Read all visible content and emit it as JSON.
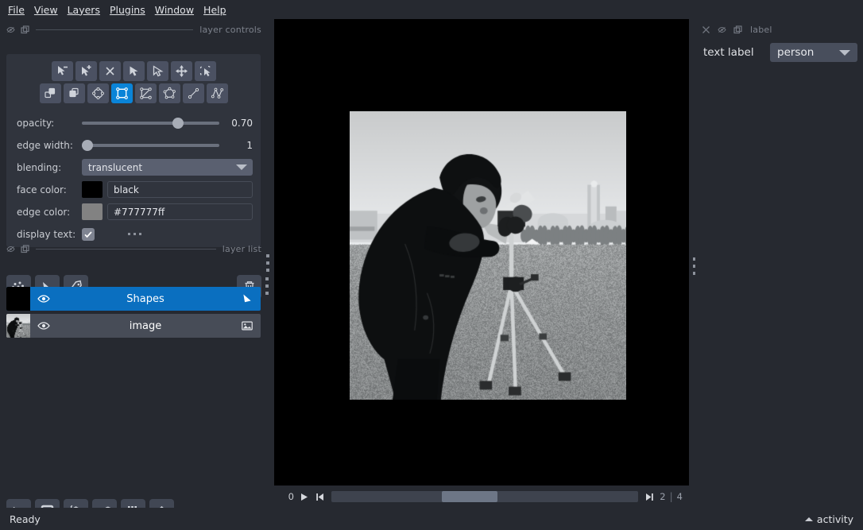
{
  "menubar": {
    "items": [
      {
        "label": "File",
        "mnemonic": "F"
      },
      {
        "label": "View",
        "mnemonic": "V"
      },
      {
        "label": "Layers",
        "mnemonic": "L"
      },
      {
        "label": "Plugins",
        "mnemonic": "P"
      },
      {
        "label": "Window",
        "mnemonic": "W"
      },
      {
        "label": "Help",
        "mnemonic": "H"
      }
    ]
  },
  "layer_controls": {
    "title": "layer controls",
    "tools_row1": [
      {
        "name": "select-subtract-tool",
        "icon": "arrow-minus-icon",
        "active": false
      },
      {
        "name": "select-add-tool",
        "icon": "arrow-plus-icon",
        "active": false
      },
      {
        "name": "delete-shape-tool",
        "icon": "close-icon",
        "active": false
      },
      {
        "name": "direct-select-tool",
        "icon": "pointer-filled-icon",
        "active": false
      },
      {
        "name": "select-tool",
        "icon": "pointer-outline-icon",
        "active": false
      },
      {
        "name": "pan-zoom-tool",
        "icon": "move-arrows-icon",
        "active": false
      },
      {
        "name": "transform-tool",
        "icon": "transform-icon",
        "active": false
      }
    ],
    "tools_row2": [
      {
        "name": "move-back-tool",
        "icon": "move-back-icon",
        "active": false
      },
      {
        "name": "move-front-tool",
        "icon": "move-front-icon",
        "active": false
      },
      {
        "name": "add-ellipse-tool",
        "icon": "ellipse-icon",
        "active": false
      },
      {
        "name": "add-rectangle-tool",
        "icon": "rectangle-icon",
        "active": true
      },
      {
        "name": "add-polygon-lasso-tool",
        "icon": "polygon-lasso-icon",
        "active": false
      },
      {
        "name": "add-polygon-tool",
        "icon": "polygon-icon",
        "active": false
      },
      {
        "name": "add-line-tool",
        "icon": "line-icon",
        "active": false
      },
      {
        "name": "add-path-tool",
        "icon": "path-icon",
        "active": false
      }
    ],
    "opacity": {
      "label": "opacity:",
      "value": "0.70",
      "percent": 70
    },
    "edge_width": {
      "label": "edge width:",
      "value": "1",
      "percent": 2
    },
    "blending": {
      "label": "blending:",
      "value": "translucent"
    },
    "face_color": {
      "label": "face color:",
      "value": "black",
      "swatch": "#000000"
    },
    "edge_color": {
      "label": "edge color:",
      "value": "#777777ff",
      "swatch": "#828282"
    },
    "display_text": {
      "label": "display text:",
      "checked": true
    }
  },
  "layer_list": {
    "title": "layer list",
    "add_buttons": [
      {
        "name": "new-points-layer-button",
        "icon": "points-icon"
      },
      {
        "name": "new-shapes-layer-button",
        "icon": "shapes-icon"
      },
      {
        "name": "new-labels-layer-button",
        "icon": "labels-tag-icon"
      }
    ],
    "delete_button": {
      "name": "delete-layer-button",
      "icon": "trash-icon"
    },
    "layers": [
      {
        "name": "Shapes",
        "type_icon": "shapes-icon",
        "visible": true,
        "selected": true,
        "thumbnail": "black"
      },
      {
        "name": "image",
        "type_icon": "image-icon",
        "visible": true,
        "selected": false,
        "thumbnail": "photo"
      }
    ]
  },
  "viewer_buttons": [
    {
      "name": "console-button",
      "icon": "console-icon"
    },
    {
      "name": "ndisplay-2d-button",
      "icon": "square-icon"
    },
    {
      "name": "roll-dims-button",
      "icon": "cube-icon"
    },
    {
      "name": "transpose-dims-button",
      "icon": "transpose-icon"
    },
    {
      "name": "grid-view-button",
      "icon": "grid-icon"
    },
    {
      "name": "reset-view-button",
      "icon": "home-icon"
    }
  ],
  "dims_slider": {
    "current": "0",
    "play_button": "play-icon",
    "first_button": "skip-previous-icon",
    "last_button": "skip-next-icon",
    "value_right": "2",
    "separator": "|",
    "max": "4",
    "handle_percent": 36,
    "handle_width_percent": 18
  },
  "right_dock": {
    "title": "label",
    "header_icons": [
      "close-icon",
      "float-icon",
      "popout-icon"
    ],
    "text_label": {
      "label": "text label",
      "value": "person"
    }
  },
  "statusbar": {
    "status": "Ready",
    "activity": "activity"
  },
  "colors": {
    "background": "#262930",
    "panel": "#30343d",
    "accent": "#0a84d8",
    "selection": "#0a6fc0",
    "button": "#4b5162",
    "text": "#d6d8dd",
    "muted": "#7d828c"
  }
}
